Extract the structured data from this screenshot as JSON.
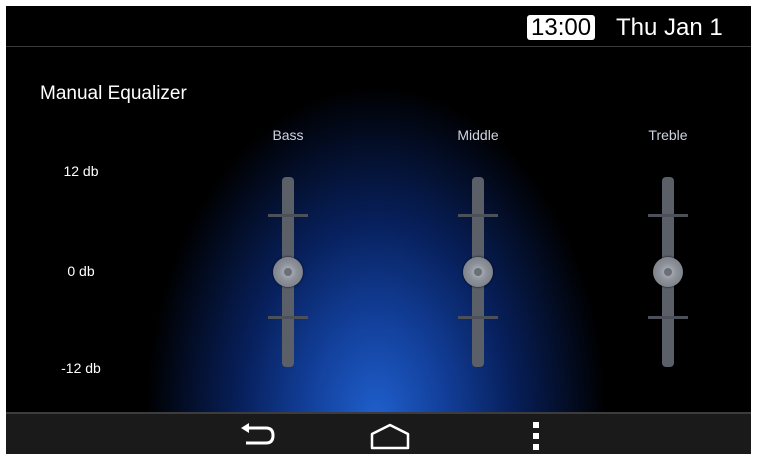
{
  "status_bar": {
    "time": "13:00",
    "date": "Thu Jan 1"
  },
  "equalizer": {
    "title": "Manual Equalizer",
    "scale_labels": {
      "max": "12 db",
      "mid": "0 db",
      "min": "-12 db"
    },
    "range_db": [
      -12,
      12
    ],
    "bands": [
      {
        "label": "Bass",
        "value_db": 0
      },
      {
        "label": "Middle",
        "value_db": 0
      },
      {
        "label": "Treble",
        "value_db": 0
      }
    ]
  },
  "nav_bar": {
    "icons": [
      "back-icon",
      "home-icon",
      "overflow-menu-icon"
    ]
  },
  "colors": {
    "background": "#000000",
    "glow": "#1f5fcc",
    "text": "#ffffff",
    "slider_track": "#5a5f68"
  }
}
